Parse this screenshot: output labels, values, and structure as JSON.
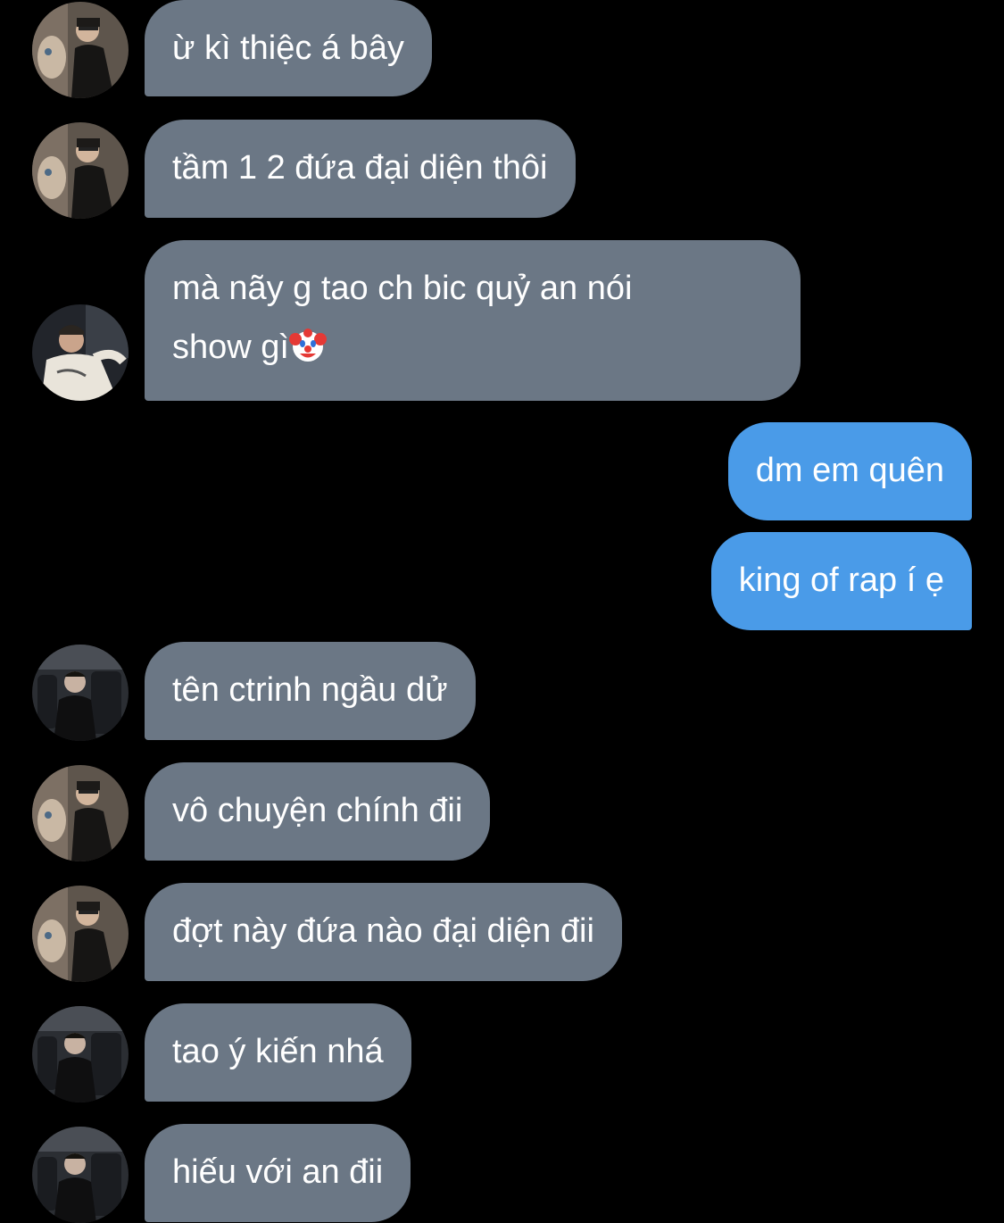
{
  "colors": {
    "background": "#000000",
    "incoming_bubble": "#6b7785",
    "outgoing_bubble": "#4a9be8",
    "text": "#ffffff"
  },
  "messages": [
    {
      "direction": "incoming",
      "avatar": "avatar-portrait-glasses",
      "text": "ừ kì thiệc á bây"
    },
    {
      "direction": "incoming",
      "avatar": "avatar-portrait-glasses",
      "text": "tầm 1 2 đứa đại diện thôi"
    },
    {
      "direction": "incoming",
      "avatar": "avatar-white-shirt",
      "text": "mà nãy g tao ch bic quỷ an nói\nshow gì",
      "emoji": "clown-face-icon"
    },
    {
      "direction": "outgoing",
      "text": "dm em quên"
    },
    {
      "direction": "outgoing",
      "text": "king of rap í ẹ"
    },
    {
      "direction": "incoming",
      "avatar": "avatar-car-seat",
      "text": "tên ctrinh ngầu dử"
    },
    {
      "direction": "incoming",
      "avatar": "avatar-portrait-glasses",
      "text": "vô chuyện chính đii"
    },
    {
      "direction": "incoming",
      "avatar": "avatar-portrait-glasses",
      "text": "đợt này đứa nào đại diện đii"
    },
    {
      "direction": "incoming",
      "avatar": "avatar-car-seat",
      "text": "tao ý kiến nhá"
    },
    {
      "direction": "incoming",
      "avatar": "avatar-car-seat",
      "text": "hiếu với an đii"
    }
  ]
}
